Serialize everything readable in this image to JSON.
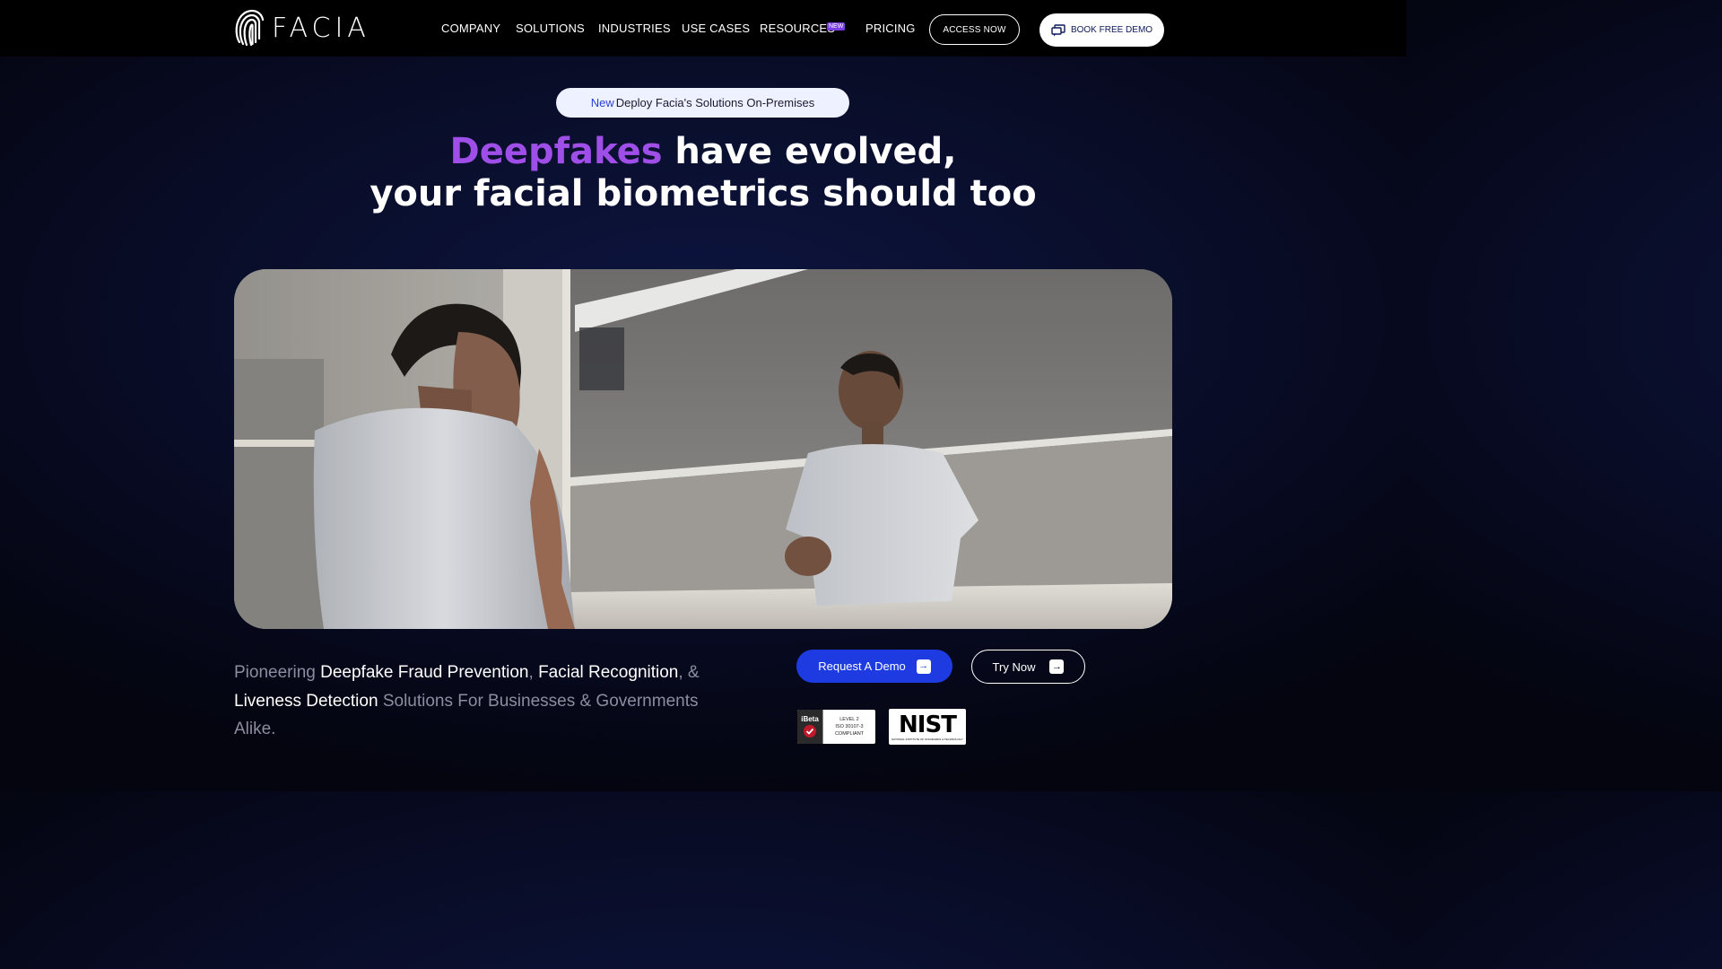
{
  "brand": {
    "name": "FACIA"
  },
  "nav": {
    "items": [
      {
        "label": "COMPANY"
      },
      {
        "label": "SOLUTIONS"
      },
      {
        "label": "INDUSTRIES"
      },
      {
        "label": "USE CASES"
      },
      {
        "label": "RESOURCES"
      },
      {
        "label": "PRICING"
      }
    ],
    "resources_badge": "NEW",
    "access_label": "ACCESS NOW",
    "demo_label": "BOOK FREE DEMO"
  },
  "announcement": {
    "tag": "New",
    "text": "Deploy Facia's Solutions On-Premises"
  },
  "headline": {
    "accent": "Deepfakes",
    "line1_rest": " have evolved,",
    "line2": "your facial biometrics should too"
  },
  "tagline": {
    "t1": "Pioneering ",
    "h1": "Deepfake Fraud Prevention",
    "t2": ", ",
    "h2": "Facial Recognition",
    "t3": ", & ",
    "h3": "Liveness Detection",
    "t4": " Solutions For Businesses & Governments Alike."
  },
  "cta": {
    "request_label": "Request A Demo",
    "try_label": "Try Now"
  },
  "badges": {
    "ibeta": {
      "logo": "iBeta",
      "level": "LEVEL 2",
      "standard": "ISO 30107-3",
      "status": "COMPLIANT"
    },
    "nist": {
      "logo": "NIST",
      "subtitle": "NATIONAL INSTITUTE OF STANDARDS & TECHNOLOGY"
    }
  },
  "icons": {
    "logo": "fingerprint-icon",
    "demo": "chat-screen-icon",
    "arrow": "arrow-right-icon"
  },
  "colors": {
    "nav_bg": "#000000",
    "accent_purple": "#a04ee8",
    "primary_blue": "#1d3be0",
    "pill_bg": "#eef1ff",
    "pill_tag": "#2a3fd4"
  }
}
